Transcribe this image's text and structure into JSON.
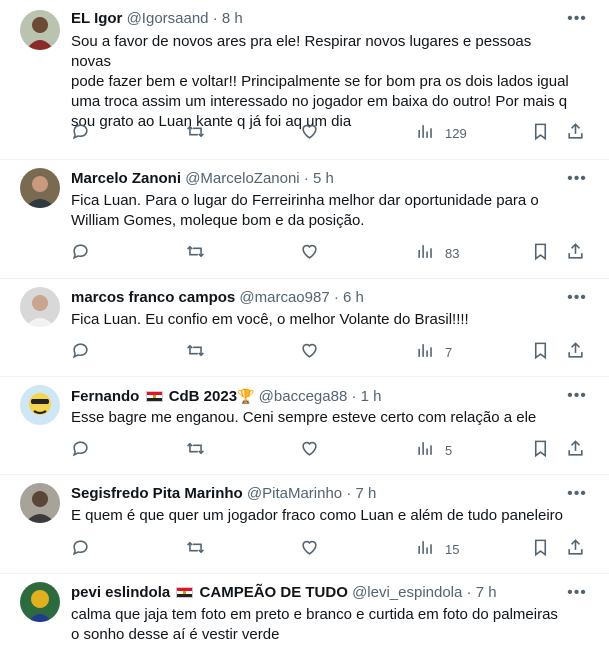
{
  "tweets": [
    {
      "name": "EL Igor",
      "handle": "@Igorsaand",
      "time": "8 h",
      "text": "Sou a favor de novos ares pra ele! Respirar novos lugares e pessoas novas\npode fazer bem e voltar!! Principalmente se for bom pra os dois lados igual\numa troca assim um interessado no jogador em baixa do outro! Por mais q\nsou grato ao Luan kante q já foi aq um dia",
      "views": "129"
    },
    {
      "name": "Marcelo Zanoni",
      "handle": "@MarceloZanoni",
      "time": "5 h",
      "text": "Fica Luan. Para o lugar do Ferreirinha melhor dar oportunidade para o\nWilliam Gomes, moleque bom e da posição.",
      "views": "83"
    },
    {
      "name": "marcos franco campos",
      "handle": "@marcao987",
      "time": "6 h",
      "text": "Fica Luan. Eu confio em você, o melhor Volante do Brasil!!!!",
      "views": "7"
    },
    {
      "name_prefix": "Fernando",
      "name_suffix": "CdB 2023",
      "trophy": "🏆",
      "handle": "@baccega88",
      "time": "1 h",
      "text": "Esse bagre me enganou. Ceni sempre esteve certo com relação a ele",
      "views": "5"
    },
    {
      "name": "Segisfredo Pita Marinho",
      "handle": "@PitaMarinho",
      "time": "7 h",
      "text": "E quem é que quer um jogador fraco como Luan e além de tudo paneleiro",
      "views": "15"
    },
    {
      "name_prefix": "pevi eslindola",
      "name_suffix": "CAMPEÃO DE TUDO",
      "handle": "@levi_espindola",
      "time": "7 h",
      "text": "calma que jaja tem foto em preto e branco e curtida em foto do palmeiras\no sonho desse aí é vestir verde"
    }
  ],
  "ui": {
    "separator": "·",
    "more_glyph": "•••"
  },
  "icons": [
    "reply-icon",
    "retweet-icon",
    "like-icon",
    "views-icon",
    "bookmark-icon",
    "share-icon",
    "more-icon"
  ],
  "colors": {
    "text": "#0f1419",
    "muted": "#536471",
    "divider": "#eff3f4"
  }
}
